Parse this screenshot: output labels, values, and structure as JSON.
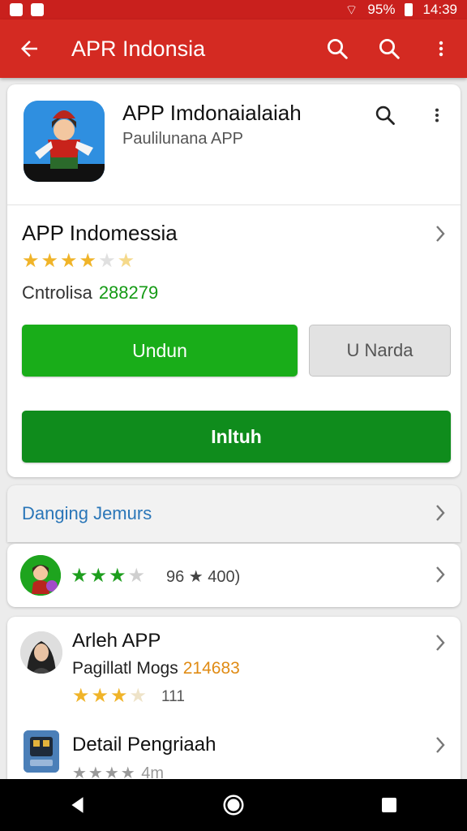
{
  "status_bar": {
    "battery": "95%",
    "time": "14:39"
  },
  "app_bar": {
    "title": "APR Indonsia"
  },
  "header": {
    "app_title": "APP Imdonaialaiah",
    "app_subtitle": "Paulilunana APP"
  },
  "details": {
    "name": "APP Indomessia",
    "rating": 3.5,
    "info_label": "Cntrolisa",
    "info_number": "288279"
  },
  "buttons": {
    "primary": "Undun",
    "secondary": "U Narda",
    "install": "Inltuh"
  },
  "section": {
    "title": "Danging Jemurs"
  },
  "reviews": {
    "rating": 3,
    "count_text": "96 ★ 400)"
  },
  "related": {
    "title": "Arleh APP",
    "subtitle": "Pagillatl Mogs",
    "subtitle_number": "214683",
    "rating": 3,
    "count": "111"
  },
  "detail_item": {
    "title": "Detail Pengriaah",
    "faded_text": "4m"
  },
  "colors": {
    "app_bar": "#d42a22",
    "status_bar": "#c9201d",
    "green_button": "#19ad19",
    "install_button": "#0f8c1c",
    "star_gold": "#f0b429",
    "star_green": "#1e9e1e",
    "link_blue": "#2a76b8"
  }
}
